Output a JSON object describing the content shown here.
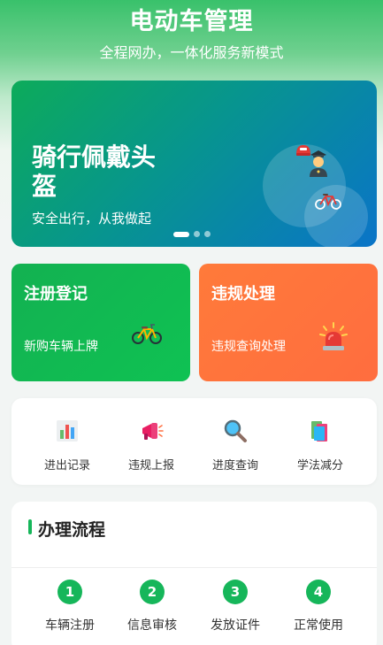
{
  "header": {
    "title": "电动车管理",
    "subtitle": "全程网办，一体化服务新模式"
  },
  "banner": {
    "title": "骑行佩戴头盔",
    "subtitle": "安全出行，从我做起",
    "dots_count": 3,
    "active_dot": 1
  },
  "cards": {
    "register": {
      "title": "注册登记",
      "subtitle": "新购车辆上牌"
    },
    "violation": {
      "title": "违规处理",
      "subtitle": "违规查询处理"
    }
  },
  "quick_actions": [
    {
      "label": "进出记录",
      "icon": "bar-chart-icon"
    },
    {
      "label": "违规上报",
      "icon": "megaphone-icon"
    },
    {
      "label": "进度查询",
      "icon": "magnifier-icon"
    },
    {
      "label": "学法减分",
      "icon": "books-icon"
    }
  ],
  "process": {
    "title": "办理流程",
    "steps": [
      {
        "num": "1",
        "label": "车辆注册"
      },
      {
        "num": "2",
        "label": "信息审核"
      },
      {
        "num": "3",
        "label": "发放证件"
      },
      {
        "num": "4",
        "label": "正常使用"
      }
    ]
  },
  "colors": {
    "primary_green": "#16b65a",
    "violation_orange": "#ff7a3a",
    "banner_blue": "#0a74c8"
  }
}
